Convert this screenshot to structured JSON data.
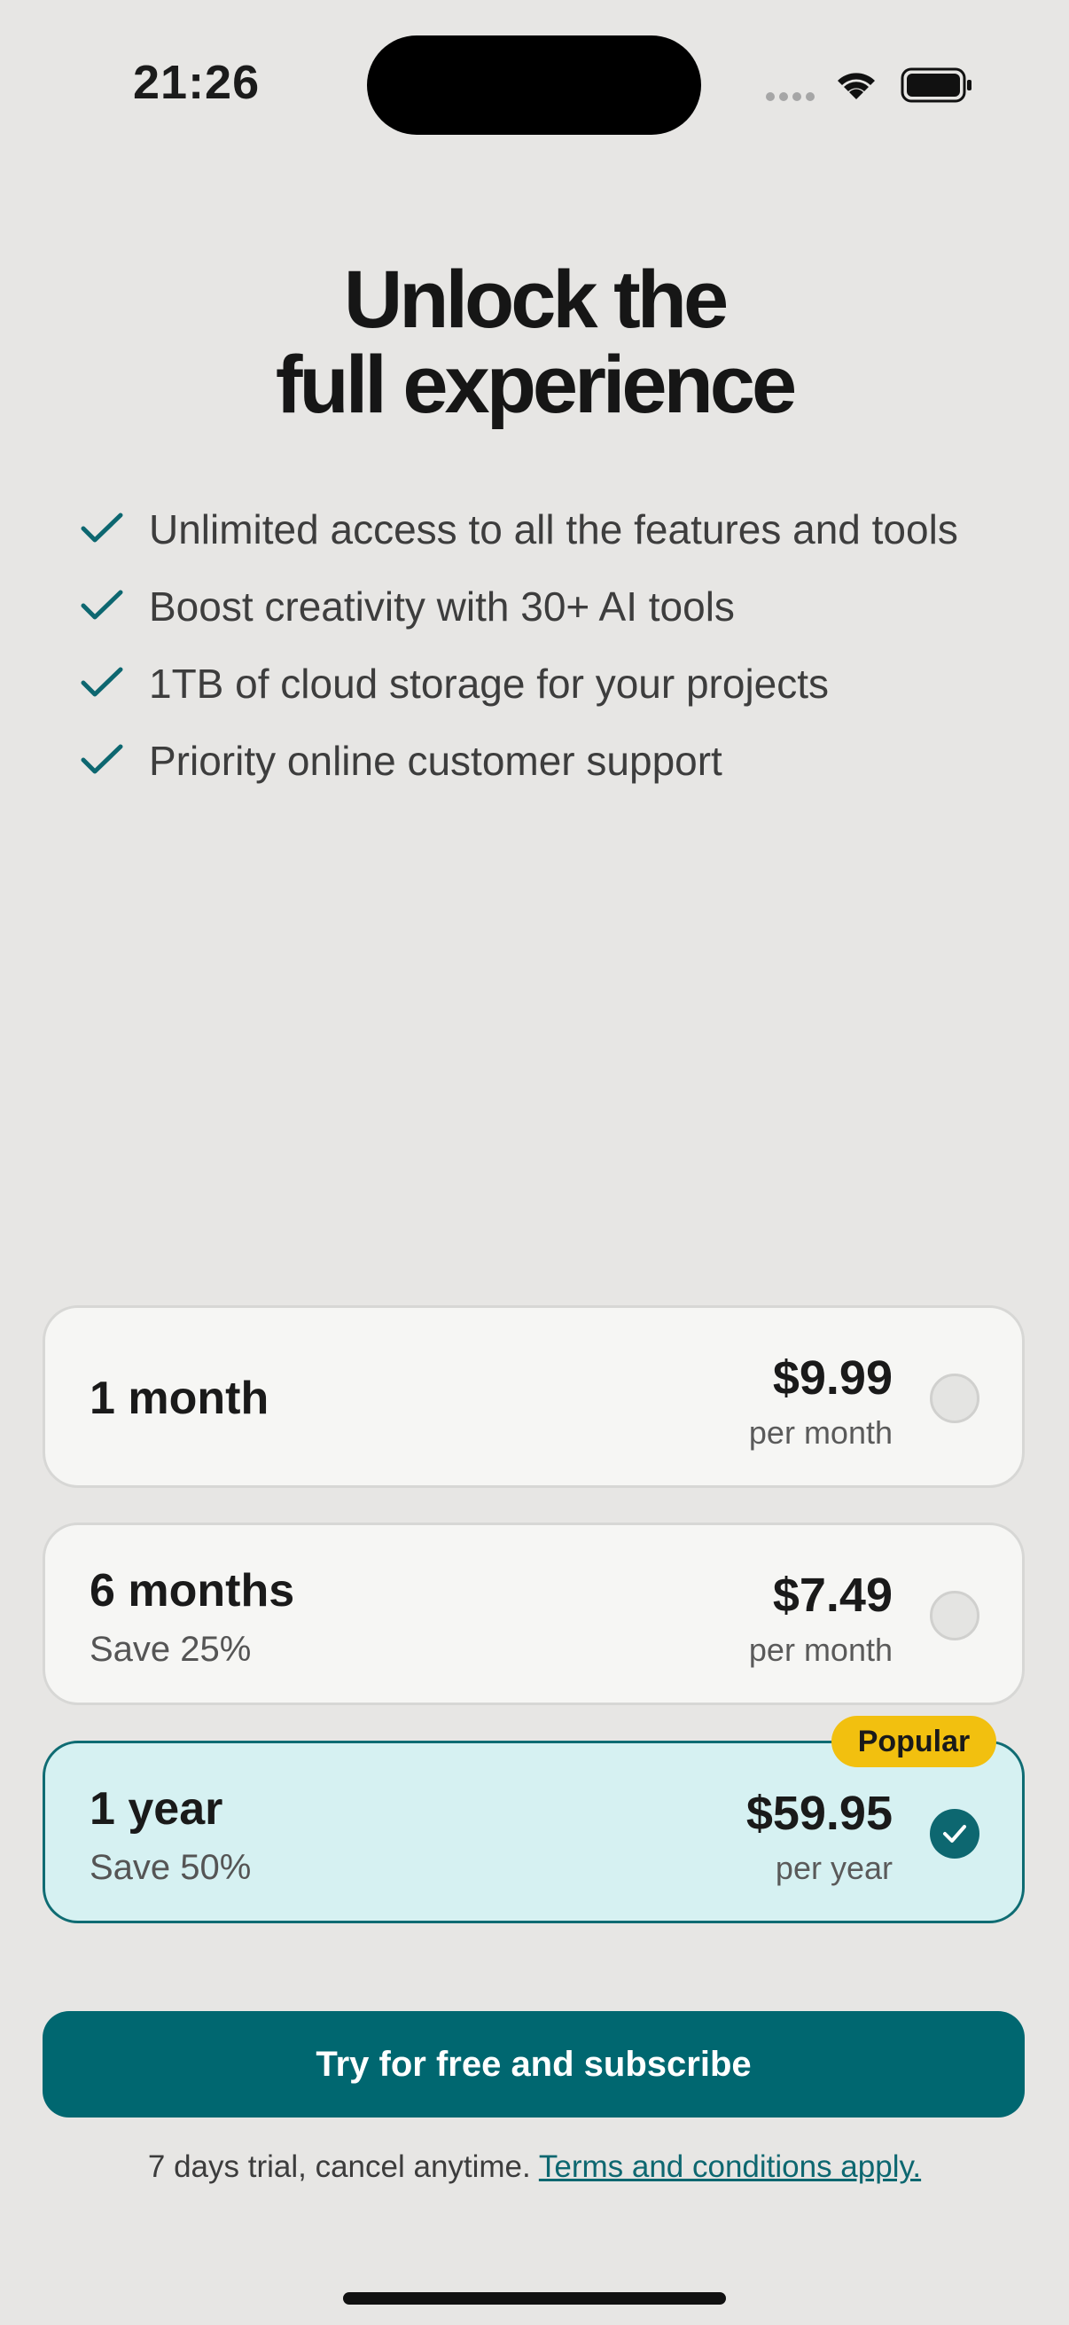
{
  "status_bar": {
    "time": "21:26"
  },
  "header": {
    "title_line1": "Unlock the",
    "title_line2": "full experience"
  },
  "features": [
    {
      "text": "Unlimited access to all the features and tools"
    },
    {
      "text": "Boost creativity with 30+ AI tools"
    },
    {
      "text": "1TB of cloud storage for your projects"
    },
    {
      "text": "Priority online customer support"
    }
  ],
  "plans": [
    {
      "name": "1 month",
      "save": "",
      "price": "$9.99",
      "period": "per month",
      "selected": false
    },
    {
      "name": "6 months",
      "save": "Save 25%",
      "price": "$7.49",
      "period": "per month",
      "selected": false
    },
    {
      "name": "1 year",
      "save": "Save 50%",
      "price": "$59.95",
      "period": "per year",
      "selected": true,
      "badge": "Popular"
    }
  ],
  "cta": {
    "label": "Try for free and subscribe"
  },
  "footnote": {
    "text": "7 days trial, cancel anytime.",
    "link": "Terms and conditions apply."
  },
  "colors": {
    "background": "#e7e6e4",
    "accent": "#006770",
    "selected_plan_bg": "#d6f1f2",
    "badge": "#f2c00f"
  }
}
